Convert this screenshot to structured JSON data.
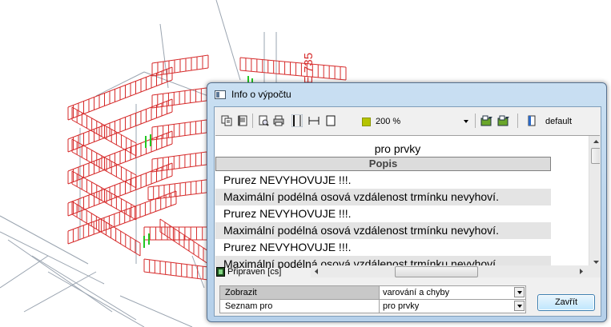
{
  "background": {
    "axis_label": "1-6/E 735",
    "colors": {
      "structure": "#d62a2a",
      "wire": "#9aa4b0",
      "highlight": "#22c722"
    }
  },
  "dialog": {
    "title": "Info o výpočtu",
    "toolbar": {
      "icons": [
        "copy-icon",
        "document-icon",
        "print-preview-icon",
        "printer-icon",
        "layout-portrait-icon",
        "layout-fit-icon",
        "page-icon",
        "color-swatch-icon",
        "export-icon",
        "export-all-icon",
        "template-icon"
      ],
      "zoom_value": "200 %",
      "template_value": "default"
    },
    "report": {
      "title": "pro prvky",
      "column_header": "Popis",
      "rows": [
        "Prurez NEVYHOVUJE !!!.",
        "Maximální podélná osová vzdálenost trmínku nevyhoví.",
        "Prurez NEVYHOVUJE !!!.",
        "Maximální podélná osová vzdálenost trmínku nevyhoví.",
        "Prurez NEVYHOVUJE !!!.",
        "Maximální podélná osová vzdálenost trmínku nevyhoví."
      ]
    },
    "status_text": "Připraven [cs]",
    "properties": [
      {
        "label": "Zobrazit",
        "value": "varování a chyby"
      },
      {
        "label": "Seznam pro",
        "value": "pro prvky"
      }
    ],
    "close_label": "Zavřít"
  }
}
